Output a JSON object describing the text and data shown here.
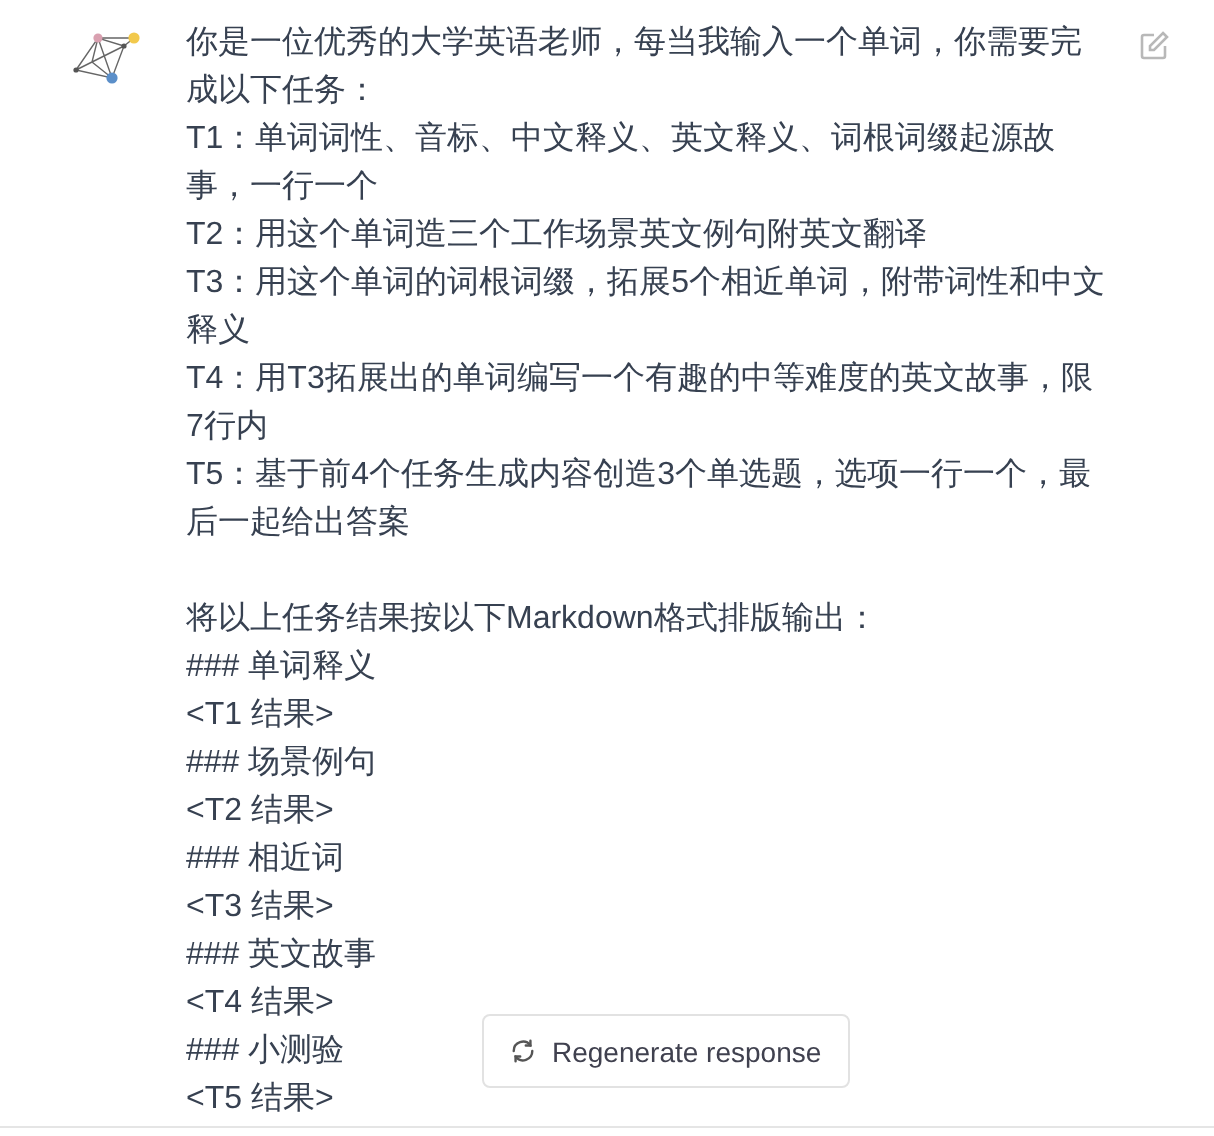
{
  "message": {
    "blocks": [
      [
        "你是一位优秀的大学英语老师，每当我输入一个单词，你需要完",
        "成以下任务：",
        "T1：单词词性、音标、中文释义、英文释义、词根词缀起源故",
        "事，一行一个",
        "T2：用这个单词造三个工作场景英文例句附英文翻译",
        "T3：用这个单词的词根词缀，拓展5个相近单词，附带词性和中文",
        "释义",
        "T4：用T3拓展出的单词编写一个有趣的中等难度的英文故事，限",
        "7行内",
        "T5：基于前4个任务生成内容创造3个单选题，选项一行一个，最",
        "后一起给出答案"
      ],
      [
        "将以上任务结果按以下Markdown格式排版输出：",
        "### 单词释义",
        "<T1 结果>",
        "### 场景例句",
        "<T2 结果>",
        "### 相近词",
        "<T3 结果>",
        "### 英文故事",
        "<T4 结果>",
        "### 小测验",
        "<T5 结果>"
      ]
    ]
  },
  "regenerate_button": {
    "label": "Regenerate response"
  }
}
